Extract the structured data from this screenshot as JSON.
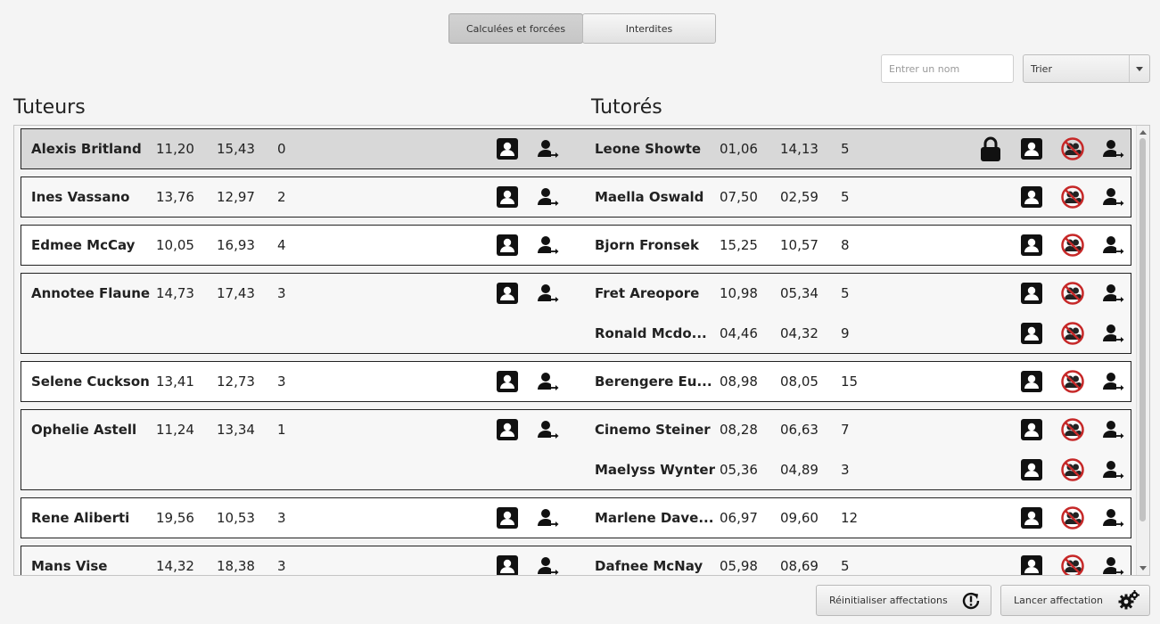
{
  "tabs": [
    {
      "label": "Calculées et forcées",
      "active": true
    },
    {
      "label": "Interdites",
      "active": false
    }
  ],
  "search": {
    "placeholder": "Entrer un nom",
    "value": ""
  },
  "sort": {
    "value": "Trier"
  },
  "sections": {
    "tuteurs": "Tuteurs",
    "tutores": "Tutorés"
  },
  "colors": {
    "valid": "#6cbf6c",
    "invalid": "#c55050",
    "warning": "#e0a04a",
    "selected": "#d8d8d8"
  },
  "pairs": [
    {
      "status": "valid",
      "selected": true,
      "locked": true,
      "tutor": {
        "name": "Alexis Britland",
        "v1": "11,20",
        "v2": "15,43",
        "v3": "0"
      },
      "tutees": [
        {
          "name": "Leone Showte",
          "v1": "01,06",
          "v2": "14,13",
          "v3": "5"
        }
      ]
    },
    {
      "status": "invalid",
      "tutor": {
        "name": "Ines Vassano",
        "v1": "13,76",
        "v2": "12,97",
        "v3": "2"
      },
      "tutees": [
        {
          "name": "Maella Oswald",
          "v1": "07,50",
          "v2": "02,59",
          "v3": "5"
        }
      ]
    },
    {
      "status": "invalid",
      "tutor": {
        "name": "Edmee McCay",
        "v1": "10,05",
        "v2": "16,93",
        "v3": "4"
      },
      "tutees": [
        {
          "name": "Bjorn Fronsek",
          "v1": "15,25",
          "v2": "10,57",
          "v3": "8"
        }
      ]
    },
    {
      "status": "valid",
      "tutor": {
        "name": "Annotee Flaune",
        "v1": "14,73",
        "v2": "17,43",
        "v3": "3"
      },
      "tutees": [
        {
          "name": "Fret Areopore",
          "v1": "10,98",
          "v2": "05,34",
          "v3": "5"
        },
        {
          "name": "Ronald Mcdo...",
          "v1": "04,46",
          "v2": "04,32",
          "v3": "9"
        }
      ]
    },
    {
      "status": "invalid",
      "tutor": {
        "name": "Selene Cuckson",
        "v1": "13,41",
        "v2": "12,73",
        "v3": "3"
      },
      "tutees": [
        {
          "name": "Berengere Eu...",
          "v1": "08,98",
          "v2": "08,05",
          "v3": "15"
        }
      ]
    },
    {
      "status": "warning",
      "tutor": {
        "name": "Ophelie Astell",
        "v1": "11,24",
        "v2": "13,34",
        "v3": "1"
      },
      "tutees": [
        {
          "name": "Cinemo Steiner",
          "v1": "08,28",
          "v2": "06,63",
          "v3": "7"
        },
        {
          "name": "Maelyss Wynter",
          "v1": "05,36",
          "v2": "04,89",
          "v3": "3"
        }
      ]
    },
    {
      "status": "invalid",
      "tutor": {
        "name": "Rene Aliberti",
        "v1": "19,56",
        "v2": "10,53",
        "v3": "3"
      },
      "tutees": [
        {
          "name": "Marlene Dave...",
          "v1": "06,97",
          "v2": "09,60",
          "v3": "12"
        }
      ]
    },
    {
      "status": "valid",
      "tutor": {
        "name": "Mans Vise",
        "v1": "14,32",
        "v2": "18,38",
        "v3": "3"
      },
      "tutees": [
        {
          "name": "Dafnee McNay",
          "v1": "05,98",
          "v2": "08,69",
          "v3": "5"
        }
      ]
    }
  ],
  "icons": {
    "profile": "profile-card-icon",
    "assign": "user-assign-icon",
    "forbid": "forbid-pair-icon",
    "lock": "lock-icon"
  },
  "buttons": {
    "reset": "Réinitialiser affectations",
    "run": "Lancer affectation"
  }
}
